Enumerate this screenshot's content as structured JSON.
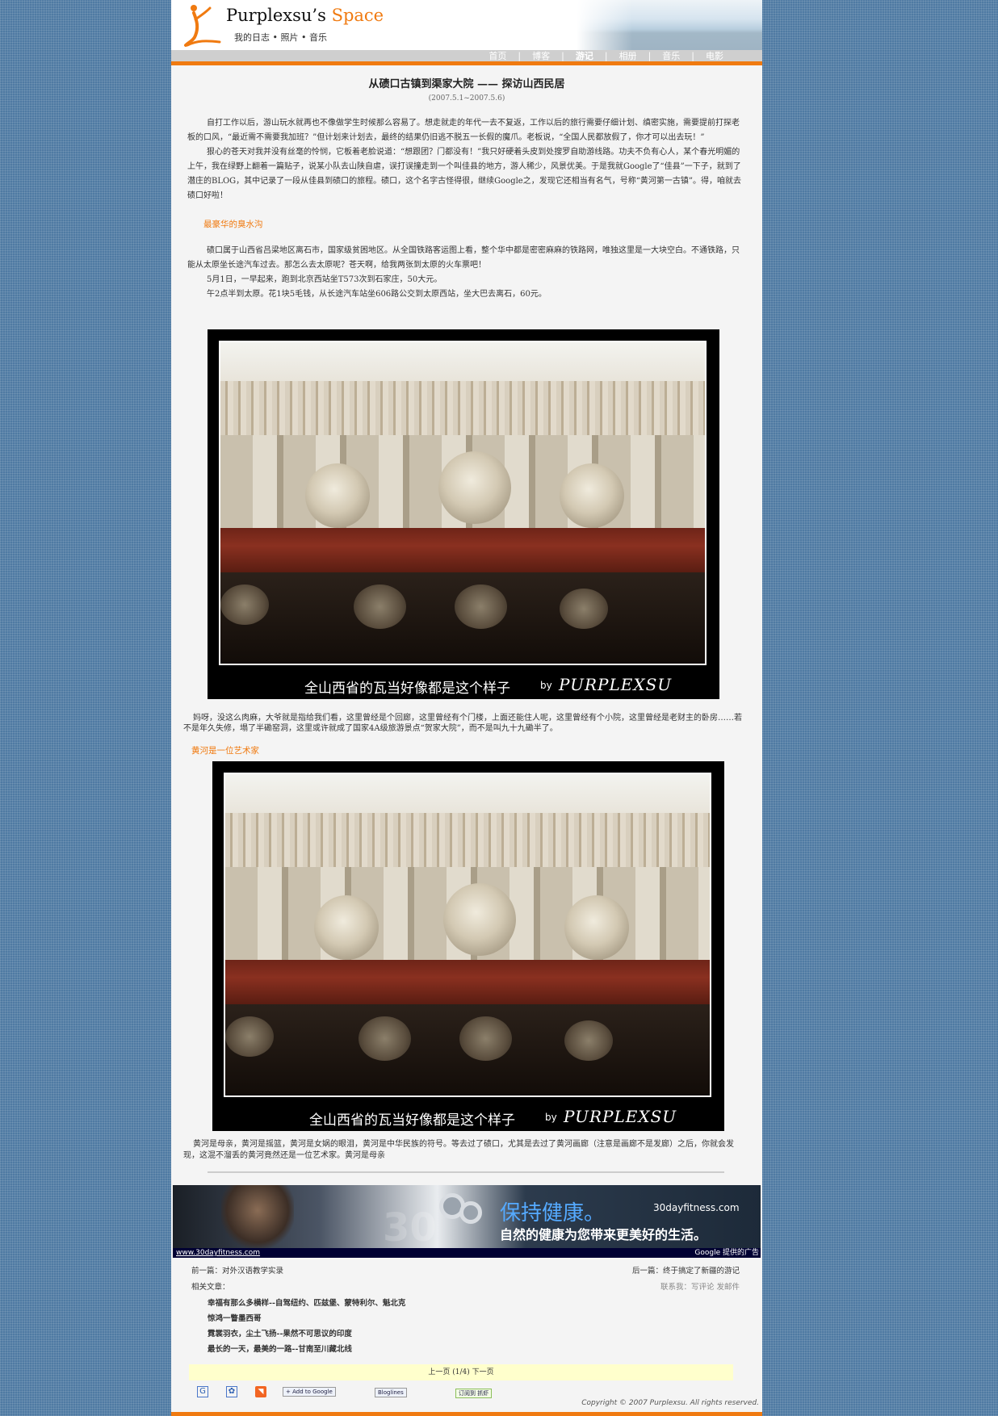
{
  "header": {
    "title_main": "Purplexsu’s ",
    "title_accent": "Space",
    "subtitle": "我的日志 • 照片 • 音乐"
  },
  "nav": {
    "items": [
      {
        "label": "首页"
      },
      {
        "label": "博客"
      },
      {
        "label": "游记"
      },
      {
        "label": "相册"
      },
      {
        "label": "音乐"
      },
      {
        "label": "电影"
      }
    ],
    "separator": "|"
  },
  "article": {
    "title": "从碛口古镇到渠家大院 —— 探访山西民居",
    "date": "(2007.5.1~2007.5.6)",
    "intro": [
      "自打工作以后，游山玩水就再也不像做学生时候那么容易了。想走就走的年代一去不复返，工作以后的旅行需要仔细计划、缜密实施，需要提前打探老板的口风，“最近需不需要我加班？”但计划来计划去，最终的结果仍旧逃不脱五一长假的魔爪。老板说，“全国人民都放假了，你才可以出去玩！”",
      "狠心的苍天对我并没有丝毫的怜悯，它板着老脸说道：“想跟团？门都没有！”我只好硬着头皮到处搜罗自助游线路。功夫不负有心人，某个春光明媚的上午，我在绿野上翻着一篇贴子，说某小队去山陕自虐，误打误撞走到一个叫佳县的地方，游人稀少，风景优美。于是我就Google了“佳县”一下子，就到了潜庄的BLOG，其中记录了一段从佳县到碛口的旅程。碛口，这个名字古怪得很，继续Google之，发现它还相当有名气，号称“黄河第一古镇”。得，咱就去碛口好啦！"
    ],
    "section1_title": "最豪华的臭水沟",
    "section1_paras": [
      "碛口属于山西省吕梁地区离石市，国家级贫困地区。从全国铁路客运图上看，整个华中都是密密麻麻的铁路网，唯独这里是一大块空白。不通铁路，只能从太原坐长途汽车过去。那怎么去太原呢？苍天啊，给我两张到太原的火车票吧！",
      "5月1日，一早起来，跑到北京西站坐T573次到石家庄，50大元。",
      "午2点半到太原。花1块5毛钱，从长途汽车站坐606路公交到太原西站，坐大巴去离石，60元。"
    ],
    "photo1": {
      "caption": "全山西省的瓦当好像都是这个样子",
      "by": "by",
      "signature": "PURPLEXSU"
    },
    "after_photo1": "妈呀，没这么肉麻，大爷就是指给我们看，这里曾经是个回廊，这里曾经有个门楼，上面还能住人呢，这里曾经有个小院，这里曾经是老财主的卧房……若不是年久失修，塌了半磡窑洞，这里或许就成了国家4A级旅游景点“贺家大院”，而不是叫九十九磡半了。",
    "section2_title": "黄河是一位艺术家",
    "photo2": {
      "caption": "全山西省的瓦当好像都是这个样子",
      "by": "by",
      "signature": "PURPLEXSU"
    },
    "after_photo2": "黄河是母亲，黄河是摇篮，黄河是女娲的眼泪，黄河是中华民族的符号。等去过了碛口，尤其是去过了黄河画廊（注意是画廊不是发廊）之后，你就会发现，这混不溜丢的黄河竟然还是一位艺术家。黄河是母亲"
  },
  "ad": {
    "headline": "保持健康。",
    "domain": "30dayfitness.com",
    "subline": "自然的健康为您带来更美好的生活。",
    "big_number": "30",
    "url": "www.30dayfitness.com",
    "provider": "Google 提供的广告"
  },
  "post_nav": {
    "prev": "前一篇：对外汉语教学实录",
    "next": "后一篇：终于搞定了新疆的游记",
    "related_label": "相关文章：",
    "contact": "联系我：写评论 发邮件",
    "related": [
      "幸福有那么多横样--自驾纽约、匹兹堡、蒙特利尔、魁北克",
      "惊鸿一瞥墨西哥",
      "霓裳羽衣，尘土飞扬--果然不可思议的印度",
      "最长的一天，最美的一路--甘南至川藏北线"
    ]
  },
  "pager": {
    "text": "上一页 (1/4) 下一页"
  },
  "badges": {
    "google_add": "+ Add to Google",
    "bloglines": "Bloglines",
    "zhuaxia": "订阅到 抓虾"
  },
  "footer": {
    "copyright": "Copyright © 2007 Purplexsu. All rights reserved."
  },
  "colors": {
    "accent": "#f07a10",
    "background": "#4f7aa3",
    "page": "#f4f4f4"
  }
}
